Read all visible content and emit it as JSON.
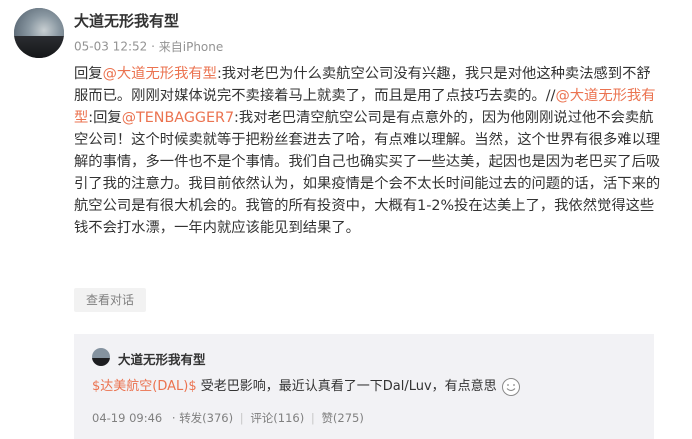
{
  "author": {
    "name": "大道无形我有型",
    "time": "05-03 12:52",
    "source": "来自iPhone"
  },
  "post": {
    "reply_prefix": "回复",
    "mention1": "@大道无形我有型",
    "text1": ":我对老巴为什么卖航空公司没有兴趣，我只是对他这种卖法感到不舒服而已。刚刚对媒体说完不卖接着马上就卖了，而且是用了点技巧去卖的。//",
    "mention2": "@大道无形我有型",
    "text2": ":回复",
    "mention3": "@TENBAGGER7",
    "text3": ":我对老巴清空航空公司是有点意外的，因为他刚刚说过他不会卖航空公司！这个时候卖就等于把粉丝套进去了哈，有点难以理解。当然，这个世界有很多难以理解的事情，多一件也不是个事情。我们自己也确实买了一些达美，起因也是因为老巴买了后吸引了我的注意力。我目前依然认为，如果疫情是个会不太长时间能过去的问题的话，活下来的航空公司是有很大机会的。我管的所有投资中，大概有1-2%投在达美上了，我依然觉得这些钱不会打水漂，一年内就应该能见到结果了。"
  },
  "view_conversation_label": "查看对话",
  "quoted": {
    "name": "大道无形我有型",
    "stock_tag": "$达美航空(DAL)$",
    "text": " 受老巴影响，最近认真看了一下Dal/Luv，有点意思",
    "time": "04-19 09:46",
    "repost": "转发(376)",
    "comment": "评论(116)",
    "like": "赞(275)",
    "separator": "·"
  },
  "colors": {
    "link": "#eb7350",
    "text": "#333333",
    "meta": "#939393",
    "quote_bg": "#f2f2f5"
  },
  "icons": [
    "avatar",
    "smile-emoji-icon"
  ]
}
